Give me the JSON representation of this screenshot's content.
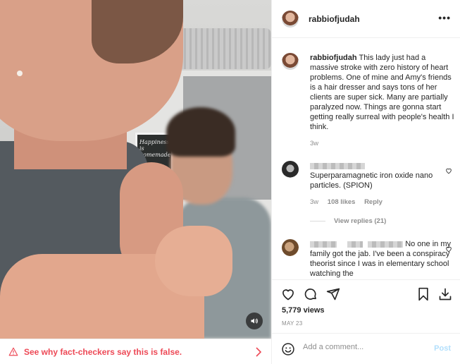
{
  "post": {
    "username": "rabbiofjudah",
    "more_label": "•••",
    "caption": {
      "username": "rabbiofjudah",
      "text": "This lady just had a massive stroke with zero history of heart problems. One of mine and Amy's friends is a hair dresser and says tons of her clients are super sick. Many are partially paralyzed now. Things are gonna start getting really surreal with people's health I think.",
      "time": "3w"
    },
    "comments": [
      {
        "text": "Superparamagnetic iron oxide nano particles. (SPION)",
        "time": "3w",
        "likes": "108 likes",
        "reply_label": "Reply",
        "view_replies": "View replies (21)"
      },
      {
        "text": "No one in my family got the jab. I've been a conspiracy theorist since I was in elementary school watching the"
      }
    ],
    "views": "5,779 views",
    "date": "MAY 23",
    "add_comment_placeholder": "Add a comment...",
    "post_button": "Post"
  },
  "media": {
    "fact_check": "See why fact-checkers say this is false.",
    "board_text": "Happiness is homemade"
  },
  "colors": {
    "accent_blue": "#0095f6",
    "post_disabled": "#b2dffc",
    "warning_red": "#ed4956",
    "muted": "#8e8e8e",
    "border": "#efefef"
  },
  "icons": {
    "sound": "speaker-icon",
    "warning": "warning-triangle-icon",
    "chevron": "chevron-right-icon",
    "like": "heart-icon",
    "comment": "comment-bubble-icon",
    "share": "paper-plane-icon",
    "save": "bookmark-icon",
    "download": "download-icon",
    "emoji": "smiley-icon"
  }
}
